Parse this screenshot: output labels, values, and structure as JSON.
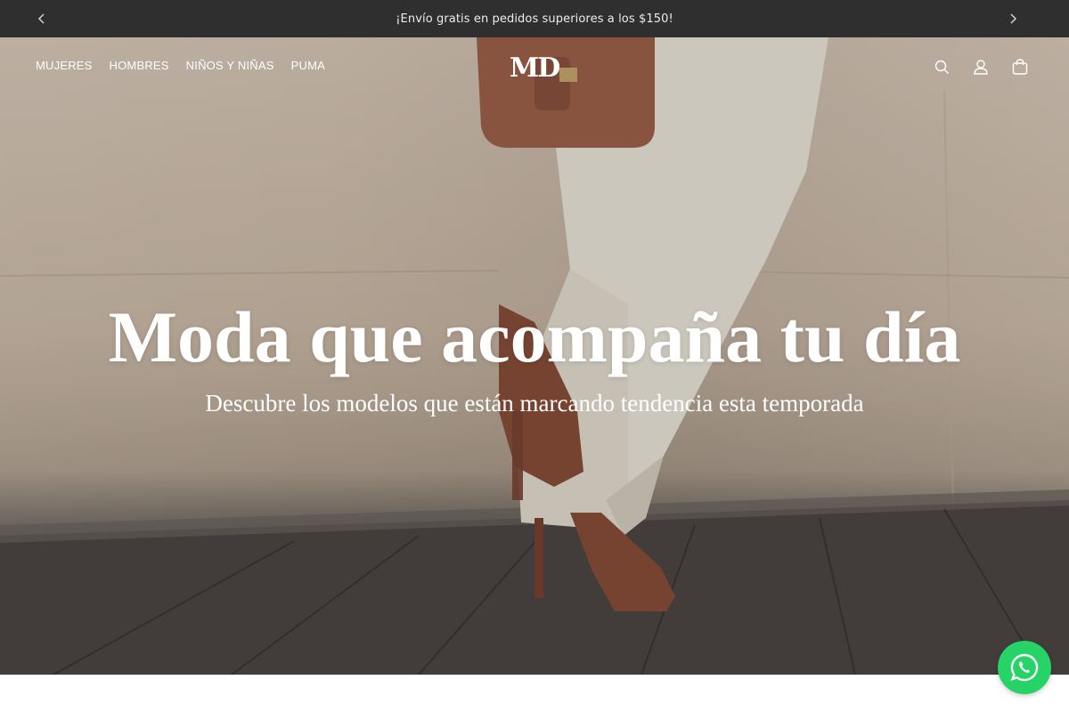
{
  "announcement": {
    "text": "¡Envío gratis en pedidos superiores a los $150!",
    "prev_icon": "chevron-left-icon",
    "next_icon": "chevron-right-icon"
  },
  "header": {
    "nav": [
      {
        "label": "MUJERES"
      },
      {
        "label": "HOMBRES"
      },
      {
        "label": "NIÑOS Y NIÑAS"
      },
      {
        "label": "PUMA"
      }
    ],
    "logo": "MD",
    "icons": [
      "search-icon",
      "account-icon",
      "cart-icon"
    ]
  },
  "hero": {
    "title": "Moda que acompaña tu día",
    "subtitle": "Descubre los modelos que están marcando tendencia esta temporada"
  },
  "colors": {
    "announcement_bg": "#2f2f2f",
    "whatsapp": "#25d366",
    "text_on_hero": "#ffffff"
  },
  "whatsapp": {
    "icon": "whatsapp-icon"
  }
}
